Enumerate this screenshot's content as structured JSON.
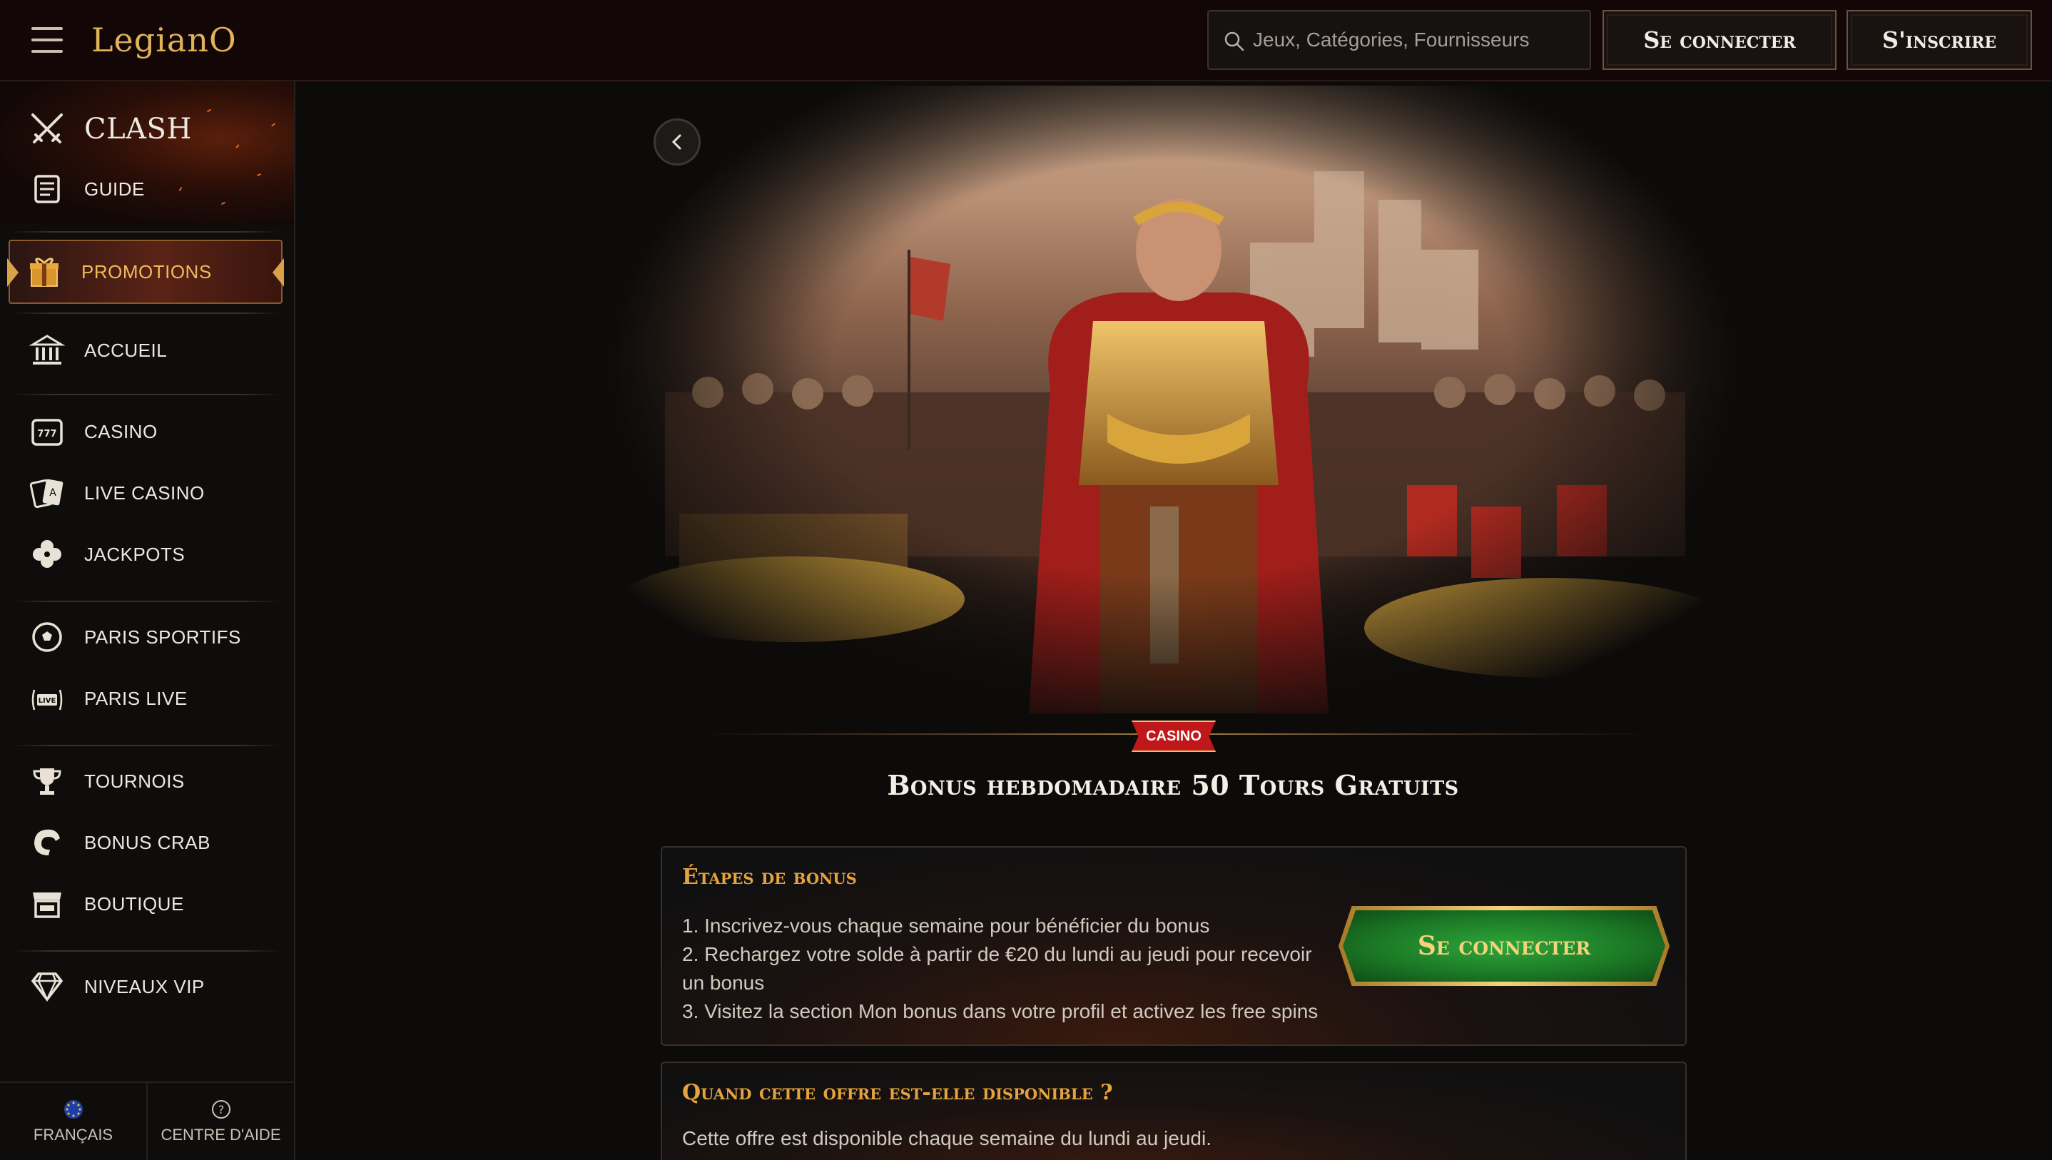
{
  "header": {
    "logo": "LegianO",
    "search_placeholder": "Jeux, Catégories, Fournisseurs",
    "login_label": "Se connecter",
    "register_label": "S'inscrire"
  },
  "sidebar": {
    "items": [
      {
        "label": "CLASH",
        "icon": "crossed-swords-icon"
      },
      {
        "label": "GUIDE",
        "icon": "scroll-icon"
      },
      {
        "label": "PROMOTIONS",
        "icon": "gift-icon"
      },
      {
        "label": "ACCUEIL",
        "icon": "temple-icon"
      },
      {
        "label": "CASINO",
        "icon": "slot-machine-icon"
      },
      {
        "label": "LIVE CASINO",
        "icon": "cards-icon"
      },
      {
        "label": "JACKPOTS",
        "icon": "clover-icon"
      },
      {
        "label": "PARIS SPORTIFS",
        "icon": "soccer-ball-icon"
      },
      {
        "label": "PARIS LIVE",
        "icon": "live-broadcast-icon"
      },
      {
        "label": "TOURNOIS",
        "icon": "trophy-icon"
      },
      {
        "label": "BONUS CRAB",
        "icon": "crab-claw-icon"
      },
      {
        "label": "BOUTIQUE",
        "icon": "shop-icon"
      },
      {
        "label": "NIVEAUX VIP",
        "icon": "diamond-icon"
      }
    ],
    "footer": {
      "language_label": "FRANÇAIS",
      "help_label": "CENTRE D'AIDE"
    }
  },
  "promo": {
    "badge": "CASINO",
    "title": "Bonus hebdomadaire 50 Tours Gratuits",
    "steps_heading": "Étapes de bonus",
    "steps": [
      "1. Inscrivez-vous chaque semaine pour bénéficier du bonus",
      "2. Rechargez votre solde à partir de €20 du lundi au jeudi pour recevoir un bonus",
      "3. Visitez la section Mon bonus dans votre profil et activez les free spins"
    ],
    "cta_label": "Se connecter",
    "availability_heading": "Quand cette offre est-elle disponible ?",
    "availability_text": "Cette offre est disponible chaque semaine du lundi au jeudi."
  },
  "colors": {
    "accent_gold": "#e4a33c",
    "header_bg": "#120706",
    "cta_green": "#1c7a26",
    "badge_red": "#c0181a"
  }
}
